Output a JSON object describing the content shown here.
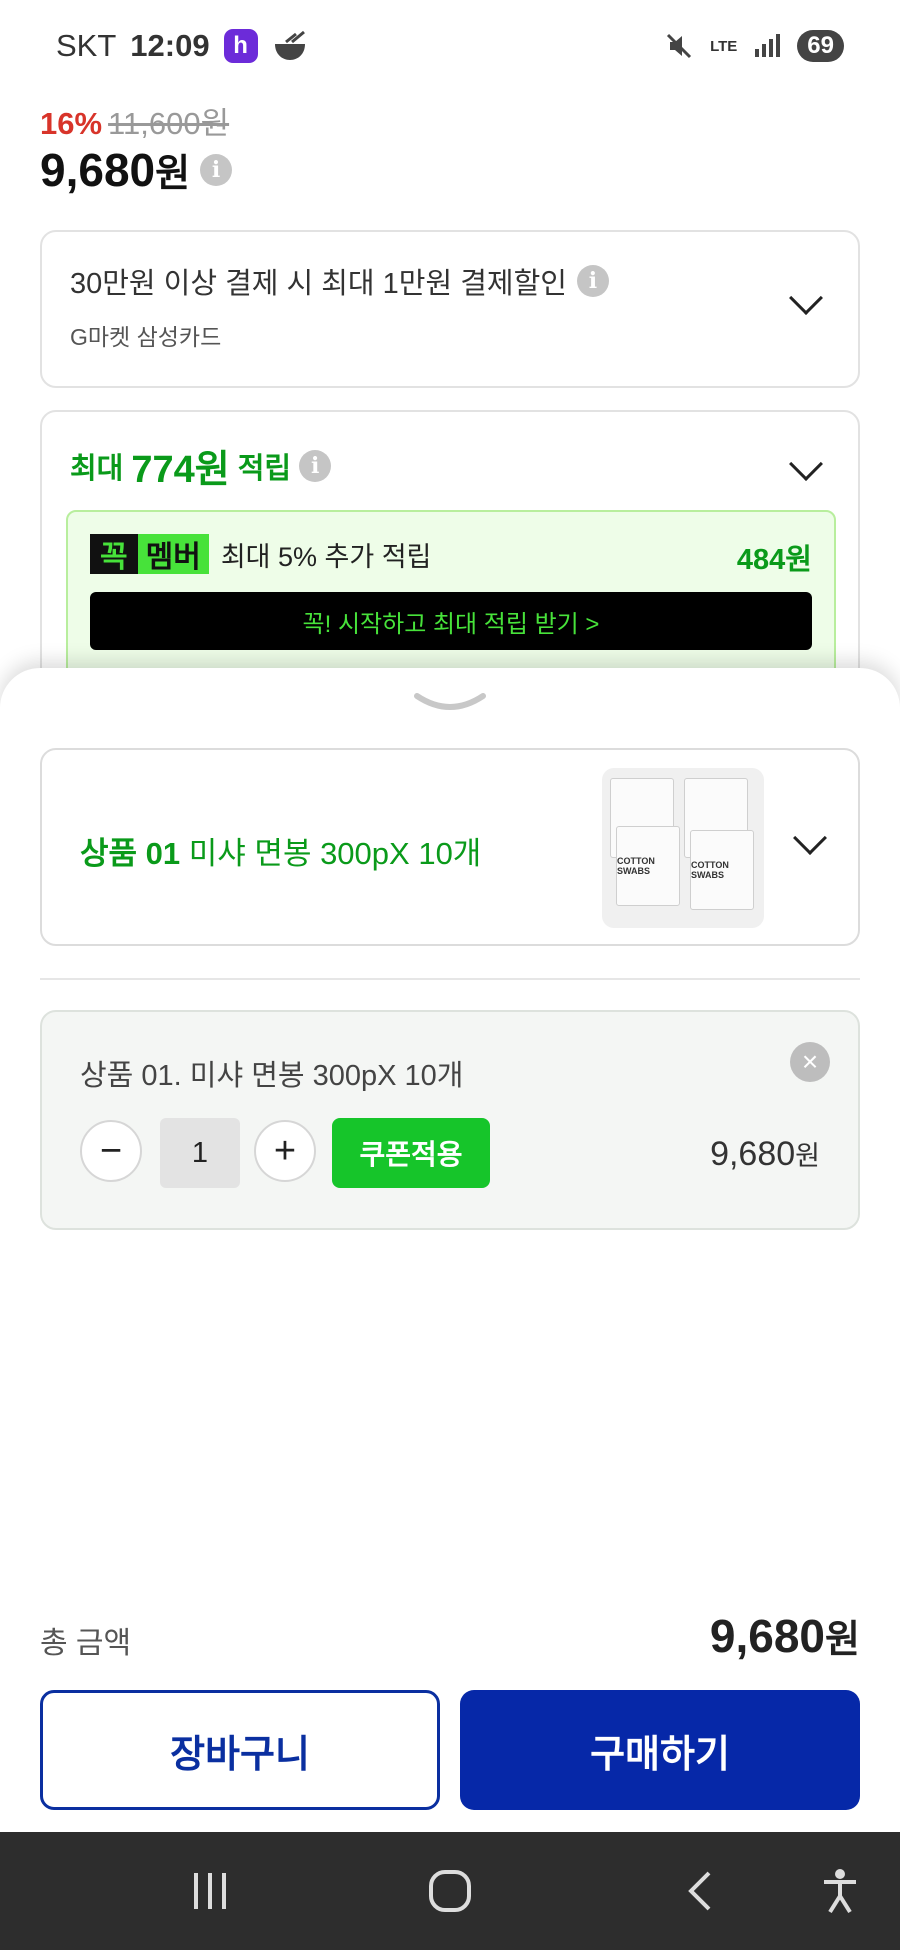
{
  "status_bar": {
    "carrier": "SKT",
    "time": "12:09",
    "app_badge": "h",
    "network": "LTE",
    "battery": "69"
  },
  "product": {
    "discount_rate": "16%",
    "original_price": "11,600원",
    "price_number": "9,680",
    "price_unit": "원"
  },
  "card_discount": {
    "title": "30만원 이상 결제 시 최대 1만원 결제할인",
    "subtitle": "G마켓 삼성카드"
  },
  "reward": {
    "prefix": "최대",
    "amount": "774원",
    "suffix": "적립",
    "membership": {
      "badge_part1": "꼭",
      "badge_part2": "멤버",
      "text": "최대 5% 추가 적립",
      "amount": "484원",
      "cta": "꼭! 시작하고 최대 적립 받기  >"
    }
  },
  "option_selector": {
    "label_bold": "상품 01",
    "label_rest": "미샤 면봉 300pX 10개",
    "thumbnail_text": "COTTON SWABS"
  },
  "selected_item": {
    "name": "상품 01. 미샤 면봉 300pX 10개",
    "quantity": "1",
    "minus": "−",
    "plus": "+",
    "coupon_label": "쿠폰적용",
    "price_number": "9,680",
    "price_unit": "원"
  },
  "footer": {
    "total_label": "총 금액",
    "total_number": "9,680",
    "total_unit": "원",
    "cart_label": "장바구니",
    "buy_label": "구매하기"
  },
  "colors": {
    "accent_green": "#0a9a1a",
    "coupon_green": "#16c52a",
    "primary_blue": "#0628a8",
    "discount_red": "#d8342a"
  }
}
